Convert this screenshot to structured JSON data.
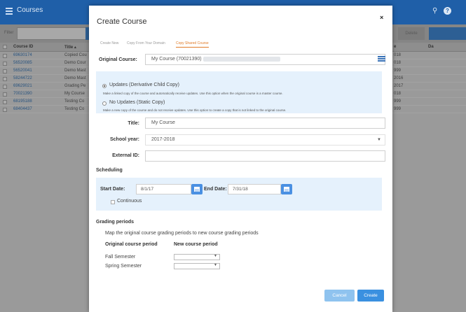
{
  "app": {
    "title": "Courses",
    "filter_label": "Filter",
    "delete_label": "Delete",
    "columns": [
      "Course ID",
      "Title ▴",
      "e",
      "Da"
    ],
    "rows": [
      {
        "id": "69630174",
        "title": "Copied Cou",
        "year": "018"
      },
      {
        "id": "56520085",
        "title": "Demo Cour",
        "year": "018"
      },
      {
        "id": "56520041",
        "title": "Demo Mast",
        "year": "999"
      },
      {
        "id": "58244722",
        "title": "Demo Mast",
        "year": "2016"
      },
      {
        "id": "69629021",
        "title": "Grading Pe",
        "year": "2017"
      },
      {
        "id": "70021390",
        "title": "My Course",
        "year": "018"
      },
      {
        "id": "68195188",
        "title": "Testing Co",
        "year": "999"
      },
      {
        "id": "68404437",
        "title": "Testing Co",
        "year": "999"
      }
    ]
  },
  "modal": {
    "title": "Create Course",
    "close": "×",
    "tabs": [
      {
        "label": "Create New"
      },
      {
        "label": "Copy From Your Domain"
      },
      {
        "label": "Copy Shared Course"
      }
    ],
    "original_course": {
      "label": "Original Course:",
      "value": "My Course (70021390)"
    },
    "updates": {
      "derivative": {
        "title": "Updates (Derivative Child Copy)",
        "desc": "Make a linked copy of the course and automatically receive updates. Use this option when the original course is a master course."
      },
      "static": {
        "title": "No Updates (Static Copy)",
        "desc": "Make a new copy of the course and do not receive updates. Use this option to create a copy that is not linked to the original course."
      }
    },
    "title_field": {
      "label": "Title:",
      "value": "My Course"
    },
    "school_year": {
      "label": "School year:",
      "value": "2017-2018"
    },
    "external_id": {
      "label": "External ID:",
      "value": ""
    },
    "scheduling": {
      "heading": "Scheduling",
      "start_label": "Start Date:",
      "start_value": "8/1/17",
      "end_label": "End Date:",
      "end_value": "7/31/18",
      "continuous_label": "Continuous"
    },
    "grading": {
      "heading": "Grading periods",
      "desc": "Map the original course grading periods to new course grading periods",
      "col_original": "Original course period",
      "col_new": "New course period",
      "periods": [
        {
          "name": "Fall Semester",
          "value": ""
        },
        {
          "name": "Spring Semester",
          "value": ""
        }
      ]
    },
    "cancel_label": "Cancel",
    "create_label": "Create"
  }
}
